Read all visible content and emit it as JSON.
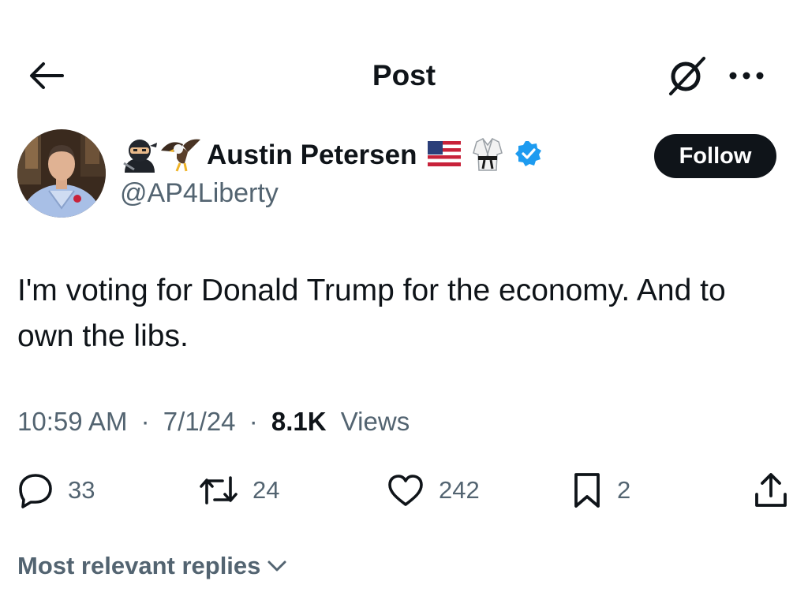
{
  "header": {
    "title": "Post",
    "icons": {
      "back": "arrow-left-icon",
      "grok": "grok-icon",
      "more": "more-horizontal-icon"
    }
  },
  "author": {
    "name_prefix_emojis": [
      "ninja-emoji",
      "eagle-emoji"
    ],
    "display_name": "Austin Petersen",
    "name_suffix_emojis": [
      "us-flag-emoji",
      "martial-arts-uniform-emoji"
    ],
    "verified_badge": "verified-badge-icon",
    "handle": "@AP4Liberty",
    "follow_label": "Follow"
  },
  "tweet": {
    "text": "I'm voting for Donald Trump for the economy. And to own the libs.",
    "time": "10:59 AM",
    "separator": "·",
    "date": "7/1/24",
    "views_count": "8.1K",
    "views_label": "Views"
  },
  "actions": {
    "replies": "33",
    "reposts": "24",
    "likes": "242",
    "bookmarks": "2"
  },
  "replies_sort": {
    "label": "Most relevant replies"
  },
  "colors": {
    "text_primary": "#0f1419",
    "text_secondary": "#536471",
    "verified_blue": "#1d9bf0",
    "follow_bg": "#0f1419"
  }
}
